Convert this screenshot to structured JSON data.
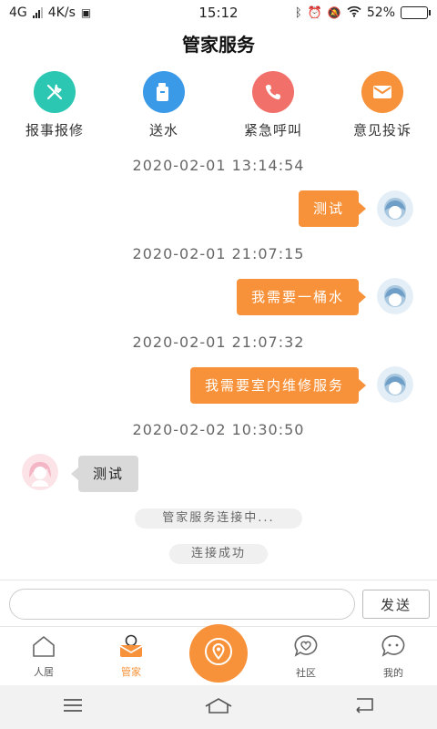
{
  "status_bar": {
    "network": "4G",
    "speed": "4K/s",
    "time": "15:12",
    "battery": "52%",
    "battery_level": 0.52
  },
  "header": {
    "title": "管家服务"
  },
  "actions": [
    {
      "label": "报事报修",
      "icon": "wrench-screwdriver-icon",
      "color": "#2bc7b2"
    },
    {
      "label": "送水",
      "icon": "water-bucket-icon",
      "color": "#3a9ae8"
    },
    {
      "label": "紧急呼叫",
      "icon": "phone-icon",
      "color": "#f2706a"
    },
    {
      "label": "意见投诉",
      "icon": "mail-icon",
      "color": "#f7923a"
    }
  ],
  "chat": {
    "messages": [
      {
        "timestamp": "2020-02-01 13:14:54",
        "text": "测试",
        "side": "right"
      },
      {
        "timestamp": "2020-02-01 21:07:15",
        "text": "我需要一桶水",
        "side": "right"
      },
      {
        "timestamp": "2020-02-01 21:07:32",
        "text": "我需要室内维修服务",
        "side": "right"
      },
      {
        "timestamp": "2020-02-02 10:30:50",
        "text": "测试",
        "side": "left"
      }
    ],
    "system": [
      "管家服务连接中...",
      "连接成功"
    ]
  },
  "input": {
    "placeholder": "",
    "send_label": "发送"
  },
  "tabs": [
    {
      "label": "人居",
      "icon": "home-icon",
      "active": false
    },
    {
      "label": "管家",
      "icon": "butler-icon",
      "active": true
    },
    {
      "label": "",
      "icon": "location-pin-icon",
      "active": false
    },
    {
      "label": "社区",
      "icon": "community-chat-icon",
      "active": false
    },
    {
      "label": "我的",
      "icon": "profile-chat-icon",
      "active": false
    }
  ],
  "colors": {
    "accent": "#f7923a",
    "left_bubble": "#d9d9d9"
  }
}
